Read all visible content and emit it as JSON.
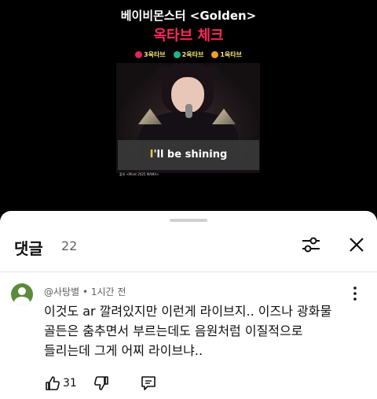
{
  "video": {
    "title": "베이비몬스터 <Golden>",
    "subtitle": "옥타브 체크",
    "legend": [
      {
        "label": "3옥타브",
        "color": "#e0245e"
      },
      {
        "label": "2옥타브",
        "color": "#1fb58a"
      },
      {
        "label": "1옥타브",
        "color": "#f0a020"
      }
    ],
    "subtitle_prefix": "I",
    "subtitle_rest": "'ll be shining",
    "credit": "출처 <Mnet 2025 MAMA>"
  },
  "comments_panel": {
    "title": "댓글",
    "count": "22",
    "filter_icon": "sliders-icon",
    "close_icon": "close-icon"
  },
  "comment": {
    "author": "@사탕별",
    "separator": " • ",
    "time": "1시간 전",
    "lines": [
      "이것도 ar 깔려있지만 이런게 라이브지.. 이즈나 광화물",
      "골든은 춤추면서 부르는데도 음원처럼 이질적으로",
      "들리는데 그게 어찌 라이브냐.."
    ],
    "likes": "31",
    "icons": {
      "like": "thumbs-up-icon",
      "dislike": "thumbs-down-icon",
      "reply": "reply-icon",
      "more": "more-vert-icon"
    }
  }
}
